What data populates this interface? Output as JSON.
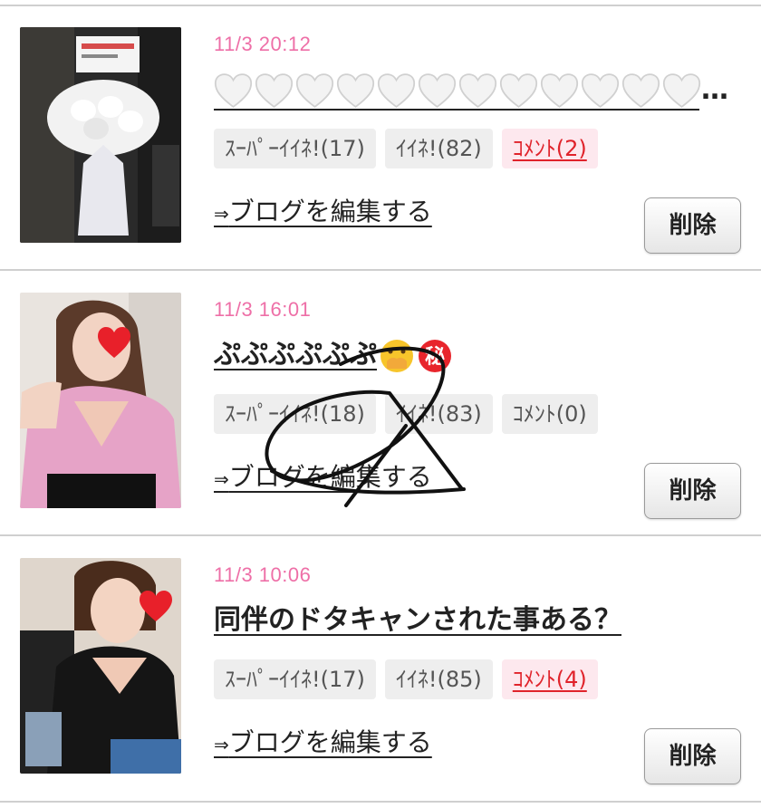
{
  "posts": [
    {
      "date": "11/3 20:12",
      "title": "",
      "title_icons": [
        "white-heart-icon",
        "white-heart-icon",
        "white-heart-icon",
        "white-heart-icon",
        "white-heart-icon",
        "white-heart-icon",
        "white-heart-icon",
        "white-heart-icon",
        "white-heart-icon",
        "white-heart-icon",
        "white-heart-icon",
        "white-heart-icon"
      ],
      "title_ellipsis": "…",
      "super_like": "ｽｰﾊﾟｰｲｲﾈ!(17)",
      "like": "ｲｲﾈ!(82)",
      "comment": "ｺﾒﾝﾄ(2)",
      "comment_has_link": true,
      "edit_link": "ブログを編集する",
      "edit_arrow": "⇒",
      "delete_label": "削除",
      "thumbnail": "flower-stand-photo"
    },
    {
      "date": "11/3 16:01",
      "title": "ぷぷぷぷぷぷ",
      "title_icons": [
        "hand-over-mouth-emoji-icon",
        "secret-circle-icon"
      ],
      "secret_glyph": "秘",
      "super_like": "ｽｰﾊﾟｰｲｲﾈ!(18)",
      "like": "ｲｲﾈ!(83)",
      "comment": "ｺﾒﾝﾄ(0)",
      "comment_has_link": false,
      "edit_link": "ブログを編集する",
      "edit_arrow": "⇒",
      "delete_label": "削除",
      "thumbnail": "woman-pink-shirt-photo"
    },
    {
      "date": "11/3 10:06",
      "title": "同伴のドタキャンされた事ある？",
      "title_icons": [],
      "super_like": "ｽｰﾊﾟｰｲｲﾈ!(17)",
      "like": "ｲｲﾈ!(85)",
      "comment": "ｺﾒﾝﾄ(4)",
      "comment_has_link": true,
      "edit_link": "ブログを編集する",
      "edit_arrow": "⇒",
      "delete_label": "削除",
      "thumbnail": "woman-black-top-photo"
    }
  ],
  "colors": {
    "date": "#ee6fa7",
    "comment_link": "#e0232b",
    "badge_bg": "#eeeeee",
    "divider": "#cfcfcf"
  }
}
